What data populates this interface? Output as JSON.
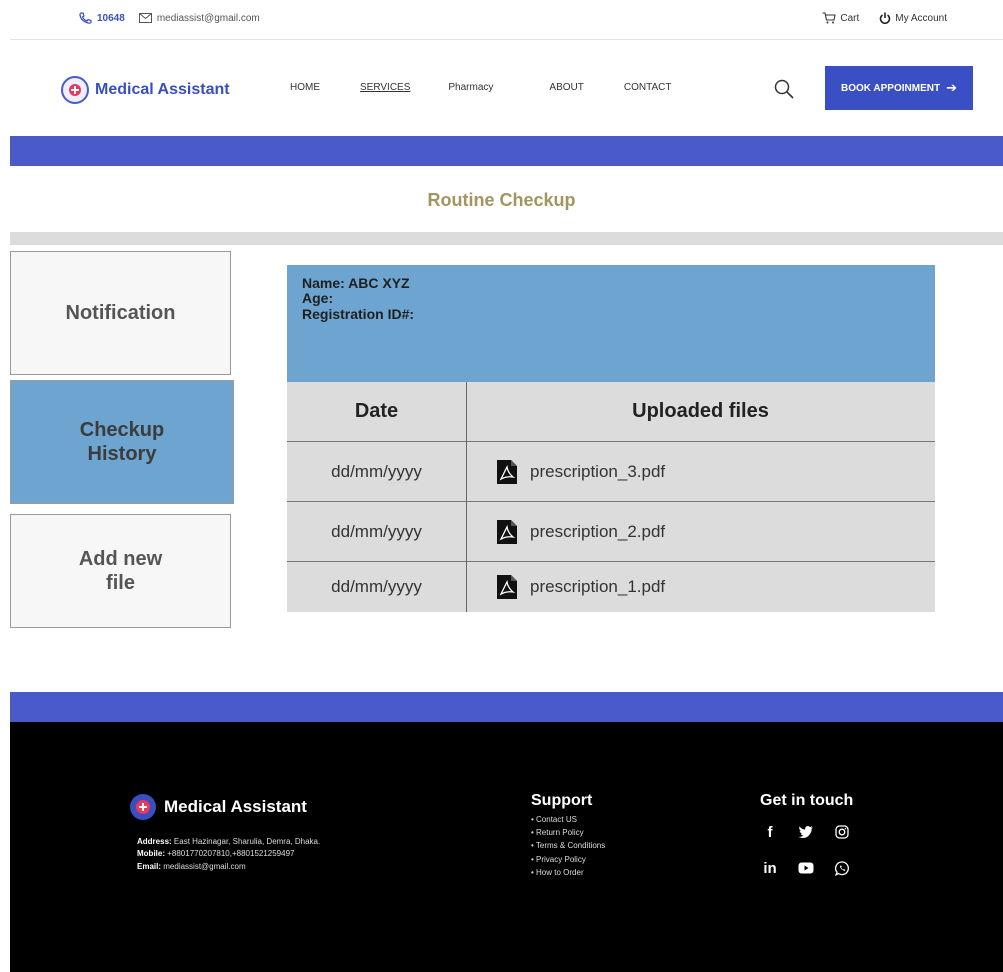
{
  "topbar": {
    "phone": "10648",
    "email": "mediassist@gmail.com",
    "cart_label": "Cart",
    "account_label": "My Account"
  },
  "brand": {
    "name": "Medical Assistant"
  },
  "nav": {
    "home": "HOME",
    "services": "SERVICES",
    "pharmacy": "Pharmacy",
    "about": "ABOUT",
    "contact": "CONTACT",
    "book_button": "BOOK APPOINMENT"
  },
  "page": {
    "title": "Routine Checkup"
  },
  "sidebar": {
    "items": [
      {
        "label": "Notification"
      },
      {
        "label": "Checkup History"
      },
      {
        "label": "Add new file"
      }
    ]
  },
  "patient": {
    "name_line": "Name:  ABC XYZ",
    "age_line": "Age:",
    "regid_line": "Registration ID#:"
  },
  "records": {
    "headers": {
      "date": "Date",
      "files": "Uploaded files"
    },
    "rows": [
      {
        "date": "dd/mm/yyyy",
        "file": "prescription_3.pdf"
      },
      {
        "date": "dd/mm/yyyy",
        "file": "prescription_2.pdf"
      },
      {
        "date": "dd/mm/yyyy",
        "file": "prescription_1.pdf"
      }
    ]
  },
  "footer": {
    "brand": "Medical Assistant",
    "address_label": "Address:",
    "address": "East Hazinagar, Sharulia, Demra, Dhaka.",
    "mobile_label": "Mobile:",
    "mobile": "+8801770207810,+8801521259497",
    "email_label": "Email:",
    "email": "mediassist@gmail.com",
    "support_title": "Support",
    "support_links": [
      "Contact US",
      "Return Policy",
      "Terms & Conditions",
      "Privacy Policy",
      "How to Order"
    ],
    "social_title": "Get in touch",
    "social_icons": [
      "facebook-icon",
      "twitter-icon",
      "instagram-icon",
      "linkedin-icon",
      "youtube-icon",
      "whatsapp-icon"
    ]
  },
  "colors": {
    "accent_blue": "#4a5bc9",
    "sky_blue": "#6ea5d0",
    "title_gold": "#a4955f"
  }
}
